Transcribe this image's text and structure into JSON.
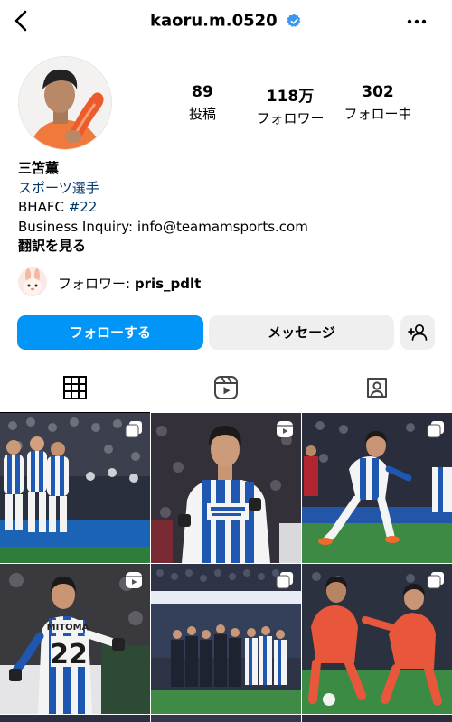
{
  "header": {
    "username": "kaoru.m.0520",
    "back_icon": "chevron-left-icon",
    "verified_icon": "verified-badge-icon",
    "more_icon": "more-horizontal-icon"
  },
  "stats": [
    {
      "number": "89",
      "label": "投稿"
    },
    {
      "number": "118万",
      "label": "フォロワー"
    },
    {
      "number": "302",
      "label": "フォロー中"
    }
  ],
  "bio": {
    "name": "三笘薫",
    "category": "スポーツ選手",
    "club": "BHAFC",
    "hashtag": "#22",
    "inquiry": "Business Inquiry: info@teamamsports.com",
    "translate": "翻訳を見る"
  },
  "followed_by": {
    "prefix": "フォロワー:",
    "username": "pris_pdlt"
  },
  "actions": {
    "follow_label": "フォローする",
    "message_label": "メッセージ",
    "add_user_icon": "add-person-icon"
  },
  "tabs": [
    {
      "icon": "grid-icon",
      "active": true
    },
    {
      "icon": "reels-icon",
      "active": false
    },
    {
      "icon": "tagged-icon",
      "active": false
    }
  ],
  "posts": [
    {
      "overlay": "carousel-icon",
      "jersey": ""
    },
    {
      "overlay": "reels-icon",
      "jersey": ""
    },
    {
      "overlay": "carousel-icon",
      "jersey": ""
    },
    {
      "overlay": "reels-icon",
      "jersey": "22"
    },
    {
      "overlay": "carousel-icon",
      "jersey": ""
    },
    {
      "overlay": "carousel-icon",
      "jersey": ""
    }
  ],
  "colors": {
    "accent": "#0095f6",
    "link": "#00376b",
    "verified": "#3897f0",
    "button_gray": "#efefef"
  }
}
